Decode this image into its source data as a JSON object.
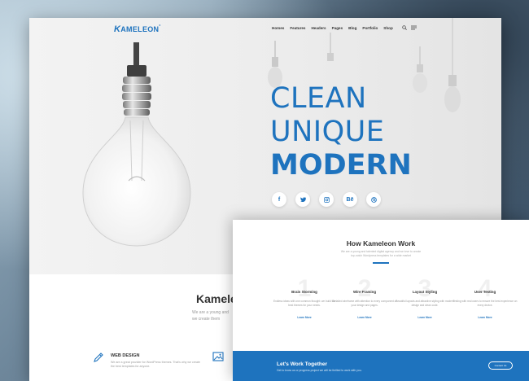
{
  "logo": {
    "text": "AMELEON",
    "mark": "K",
    "trademark": "°"
  },
  "nav": {
    "items": [
      "Homes",
      "Features",
      "Headers",
      "Pages",
      "Blog",
      "Portfolio",
      "Shop"
    ]
  },
  "hero": {
    "line1": "CLEAN",
    "line2": "UNIQUE",
    "line3": "MODERN"
  },
  "socials": [
    {
      "icon": "facebook-icon",
      "glyph": "f"
    },
    {
      "icon": "twitter-icon",
      "glyph": "✉"
    },
    {
      "icon": "instagram-icon",
      "glyph": "◎"
    },
    {
      "icon": "behance-icon",
      "glyph": "Bē"
    },
    {
      "icon": "dribbble-icon",
      "glyph": "◎"
    }
  ],
  "about": {
    "title": "Kamele",
    "sub_line1": "We are a young and",
    "sub_line2": "we create them"
  },
  "services": [
    {
      "icon": "pencil-icon",
      "title": "WEB DESIGN",
      "desc": "We are a great provider for WordPress themes. That's why we create the best templates for anyone."
    },
    {
      "icon": "image-icon",
      "title": "",
      "desc": ""
    }
  ],
  "how": {
    "title": "How Kameleon Work",
    "sub": "We are a young and talented digital agency and we love to create top-notch Wordpress templates for a wide market",
    "steps": [
      {
        "num": "1",
        "title": "Brain Storming",
        "desc": "Endless ideas with one common thought: we build the best themes for your needs.",
        "link": "Learn More"
      },
      {
        "num": "2",
        "title": "Wire Framing",
        "desc": "Detailed wireframe with attention to every component of your design and pages.",
        "link": "Learn More"
      },
      {
        "num": "3",
        "title": "Layout Styling",
        "desc": "Beautiful layouts and attractive styling with modern design and clean code.",
        "link": "Learn More"
      },
      {
        "num": "4",
        "title": "User Testing",
        "desc": "Testing with real users to ensure the best experience on every device.",
        "link": "Learn More"
      }
    ]
  },
  "cta": {
    "title": "Let's Work Together",
    "desc": "Get to know us or progress project we will be thrilled to work with you.",
    "button": "Contact Us"
  },
  "colors": {
    "accent": "#1e73be"
  }
}
